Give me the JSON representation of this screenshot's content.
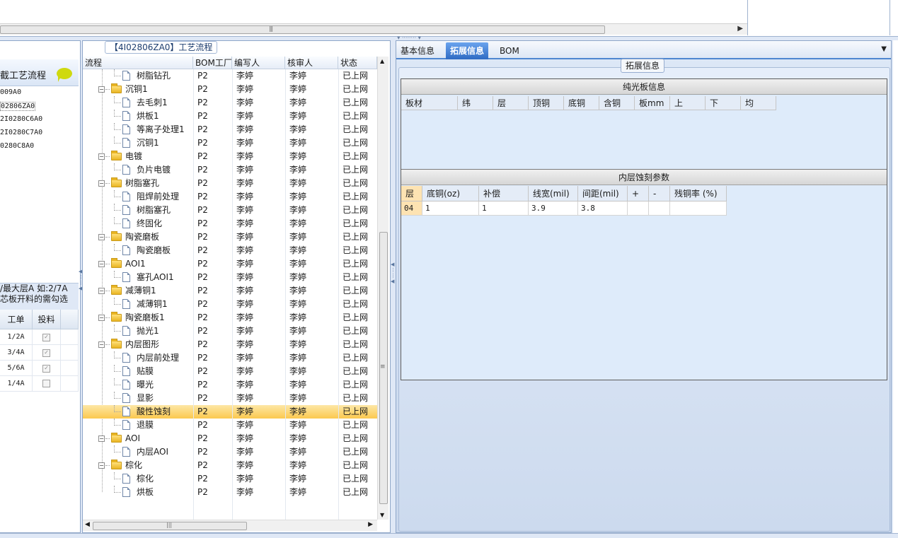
{
  "top": {
    "scroll_grip": "|||"
  },
  "left": {
    "header_title": "截工艺流程",
    "bom_items": [
      "009A0",
      "02806ZA0",
      "2I0280C6A0",
      "2I0280C7A0",
      "0280C8A0"
    ],
    "selected_bom_index": 1,
    "note_line1": "/最大层A 如:2/7A",
    "note_line2": "芯板开料的需勾选",
    "grid_headers": [
      "工单",
      "投料"
    ],
    "grid_rows": [
      {
        "order": "1/2A",
        "checked": true
      },
      {
        "order": "3/4A",
        "checked": true
      },
      {
        "order": "5/6A",
        "checked": true
      },
      {
        "order": "1/4A",
        "checked": false
      }
    ]
  },
  "middle": {
    "title": "【4I02806ZA0】工艺流程",
    "headers": [
      "流程",
      "BOM工厂",
      "编写人",
      "核审人",
      "状态"
    ],
    "selected_index": 25,
    "rows": [
      {
        "name": "树脂钻孔",
        "kind": "leaf",
        "factory": "P2",
        "writer": "李婷",
        "reviewer": "李婷",
        "status": "已上网"
      },
      {
        "name": "沉铜1",
        "kind": "folder",
        "factory": "P2",
        "writer": "李婷",
        "reviewer": "李婷",
        "status": "已上网"
      },
      {
        "name": "去毛刺1",
        "kind": "leaf",
        "factory": "P2",
        "writer": "李婷",
        "reviewer": "李婷",
        "status": "已上网"
      },
      {
        "name": "烘板1",
        "kind": "leaf",
        "factory": "P2",
        "writer": "李婷",
        "reviewer": "李婷",
        "status": "已上网"
      },
      {
        "name": "等离子处理1",
        "kind": "leaf",
        "factory": "P2",
        "writer": "李婷",
        "reviewer": "李婷",
        "status": "已上网"
      },
      {
        "name": "沉铜1",
        "kind": "leaf",
        "factory": "P2",
        "writer": "李婷",
        "reviewer": "李婷",
        "status": "已上网"
      },
      {
        "name": "电镀",
        "kind": "folder",
        "factory": "P2",
        "writer": "李婷",
        "reviewer": "李婷",
        "status": "已上网"
      },
      {
        "name": "负片电镀",
        "kind": "leaf",
        "factory": "P2",
        "writer": "李婷",
        "reviewer": "李婷",
        "status": "已上网"
      },
      {
        "name": "树脂塞孔",
        "kind": "folder",
        "factory": "P2",
        "writer": "李婷",
        "reviewer": "李婷",
        "status": "已上网"
      },
      {
        "name": "阻焊前处理",
        "kind": "leaf",
        "factory": "P2",
        "writer": "李婷",
        "reviewer": "李婷",
        "status": "已上网"
      },
      {
        "name": "树脂塞孔",
        "kind": "leaf",
        "factory": "P2",
        "writer": "李婷",
        "reviewer": "李婷",
        "status": "已上网"
      },
      {
        "name": "终固化",
        "kind": "leaf",
        "factory": "P2",
        "writer": "李婷",
        "reviewer": "李婷",
        "status": "已上网"
      },
      {
        "name": "陶瓷磨板",
        "kind": "folder",
        "factory": "P2",
        "writer": "李婷",
        "reviewer": "李婷",
        "status": "已上网"
      },
      {
        "name": "陶瓷磨板",
        "kind": "leaf",
        "factory": "P2",
        "writer": "李婷",
        "reviewer": "李婷",
        "status": "已上网"
      },
      {
        "name": "AOI1",
        "kind": "folder",
        "factory": "P2",
        "writer": "李婷",
        "reviewer": "李婷",
        "status": "已上网"
      },
      {
        "name": "塞孔AOI1",
        "kind": "leaf",
        "factory": "P2",
        "writer": "李婷",
        "reviewer": "李婷",
        "status": "已上网"
      },
      {
        "name": "减薄铜1",
        "kind": "folder",
        "factory": "P2",
        "writer": "李婷",
        "reviewer": "李婷",
        "status": "已上网"
      },
      {
        "name": "减薄铜1",
        "kind": "leaf",
        "factory": "P2",
        "writer": "李婷",
        "reviewer": "李婷",
        "status": "已上网"
      },
      {
        "name": "陶瓷磨板1",
        "kind": "folder",
        "factory": "P2",
        "writer": "李婷",
        "reviewer": "李婷",
        "status": "已上网"
      },
      {
        "name": "抛光1",
        "kind": "leaf",
        "factory": "P2",
        "writer": "李婷",
        "reviewer": "李婷",
        "status": "已上网"
      },
      {
        "name": "内层图形",
        "kind": "folder",
        "factory": "P2",
        "writer": "李婷",
        "reviewer": "李婷",
        "status": "已上网"
      },
      {
        "name": "内层前处理",
        "kind": "leaf",
        "factory": "P2",
        "writer": "李婷",
        "reviewer": "李婷",
        "status": "已上网"
      },
      {
        "name": "贴膜",
        "kind": "leaf",
        "factory": "P2",
        "writer": "李婷",
        "reviewer": "李婷",
        "status": "已上网"
      },
      {
        "name": "曝光",
        "kind": "leaf",
        "factory": "P2",
        "writer": "李婷",
        "reviewer": "李婷",
        "status": "已上网"
      },
      {
        "name": "显影",
        "kind": "leaf",
        "factory": "P2",
        "writer": "李婷",
        "reviewer": "李婷",
        "status": "已上网"
      },
      {
        "name": "酸性蚀刻",
        "kind": "leaf",
        "factory": "P2",
        "writer": "李婷",
        "reviewer": "李婷",
        "status": "已上网"
      },
      {
        "name": "退膜",
        "kind": "leaf",
        "factory": "P2",
        "writer": "李婷",
        "reviewer": "李婷",
        "status": "已上网"
      },
      {
        "name": "AOI",
        "kind": "folder",
        "factory": "P2",
        "writer": "李婷",
        "reviewer": "李婷",
        "status": "已上网"
      },
      {
        "name": "内层AOI",
        "kind": "leaf",
        "factory": "P2",
        "writer": "李婷",
        "reviewer": "李婷",
        "status": "已上网"
      },
      {
        "name": "棕化",
        "kind": "folder",
        "factory": "P2",
        "writer": "李婷",
        "reviewer": "李婷",
        "status": "已上网"
      },
      {
        "name": "棕化",
        "kind": "leaf",
        "factory": "P2",
        "writer": "李婷",
        "reviewer": "李婷",
        "status": "已上网"
      },
      {
        "name": "烘板",
        "kind": "leaf",
        "factory": "P2",
        "writer": "李婷",
        "reviewer": "李婷",
        "status": "已上网"
      }
    ]
  },
  "right": {
    "tabs": [
      "基本信息",
      "拓展信息",
      "BOM"
    ],
    "active_tab_index": 1,
    "group_title": "拓展信息",
    "plain_board": {
      "title": "纯光板信息",
      "headers": [
        "板材",
        "纬",
        "层",
        "顶铜",
        "底铜",
        "含铜",
        "板mm",
        "上",
        "下",
        "均"
      ]
    },
    "etch_params": {
      "title": "内层蚀刻参数",
      "headers": [
        "层",
        "底铜(oz)",
        "补偿",
        "线宽(mil)",
        "间距(mil)",
        "+",
        "-",
        "残铜率 (%)"
      ],
      "rows": [
        [
          "04",
          "1",
          "1",
          "3.9",
          "3.8",
          "",
          "",
          ""
        ]
      ]
    }
  }
}
